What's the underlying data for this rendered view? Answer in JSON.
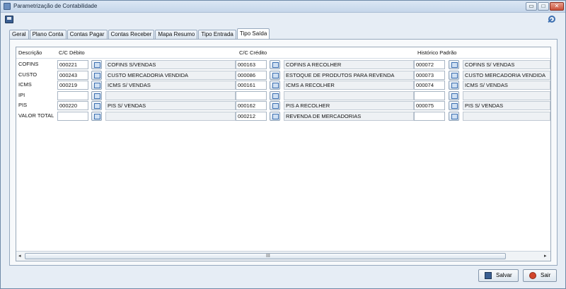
{
  "window": {
    "title": "Parametrização de Contabilidade",
    "controls": {
      "minimize": "▭",
      "restore": "□",
      "close": "✕"
    }
  },
  "tabs": [
    {
      "label": "Geral"
    },
    {
      "label": "Plano Conta"
    },
    {
      "label": "Contas Pagar"
    },
    {
      "label": "Contas Receber"
    },
    {
      "label": "Mapa Resumo"
    },
    {
      "label": "Tipo Entrada"
    },
    {
      "label": "Tipo Saída",
      "active": true
    }
  ],
  "grid": {
    "headers": {
      "descricao": "Descrição",
      "debito": "C/C Débito",
      "credito": "C/C Crédito",
      "historico": "Histórico Padrão"
    },
    "rows": [
      {
        "desc": "COFINS",
        "deb_code": "000221",
        "deb_name": "COFINS S/VENDAS",
        "cred_code": "000163",
        "cred_name": "COFINS A RECOLHER",
        "hist_code": "000072",
        "hist_name": "COFINS S/ VENDAS"
      },
      {
        "desc": "CUSTO",
        "deb_code": "000243",
        "deb_name": "CUSTO MERCADORIA VENDIDA",
        "cred_code": "000086",
        "cred_name": "ESTOQUE DE PRODUTOS PARA REVENDA",
        "hist_code": "000073",
        "hist_name": "CUSTO MERCADORIA VENDIDA"
      },
      {
        "desc": "ICMS",
        "deb_code": "000219",
        "deb_name": "ICMS S/ VENDAS",
        "cred_code": "000161",
        "cred_name": "ICMS A RECOLHER",
        "hist_code": "000074",
        "hist_name": "ICMS S/ VENDAS"
      },
      {
        "desc": "IPI",
        "deb_code": "",
        "deb_name": "",
        "cred_code": "",
        "cred_name": "",
        "hist_code": "",
        "hist_name": ""
      },
      {
        "desc": "PIS",
        "deb_code": "000220",
        "deb_name": "PIS S/ VENDAS",
        "cred_code": "000162",
        "cred_name": "PIS A RECOLHER",
        "hist_code": "000075",
        "hist_name": "PIS S/ VENDAS"
      },
      {
        "desc": "VALOR TOTAL",
        "deb_code": "",
        "deb_name": "",
        "cred_code": "000212",
        "cred_name": "REVENDA DE MERCADORIAS",
        "hist_code": "",
        "hist_name": ""
      }
    ]
  },
  "scrollbar": {
    "left": "◂",
    "right": "▸",
    "grip": "III"
  },
  "footer": {
    "save_label": "Salvar",
    "exit_label": "Sair"
  }
}
